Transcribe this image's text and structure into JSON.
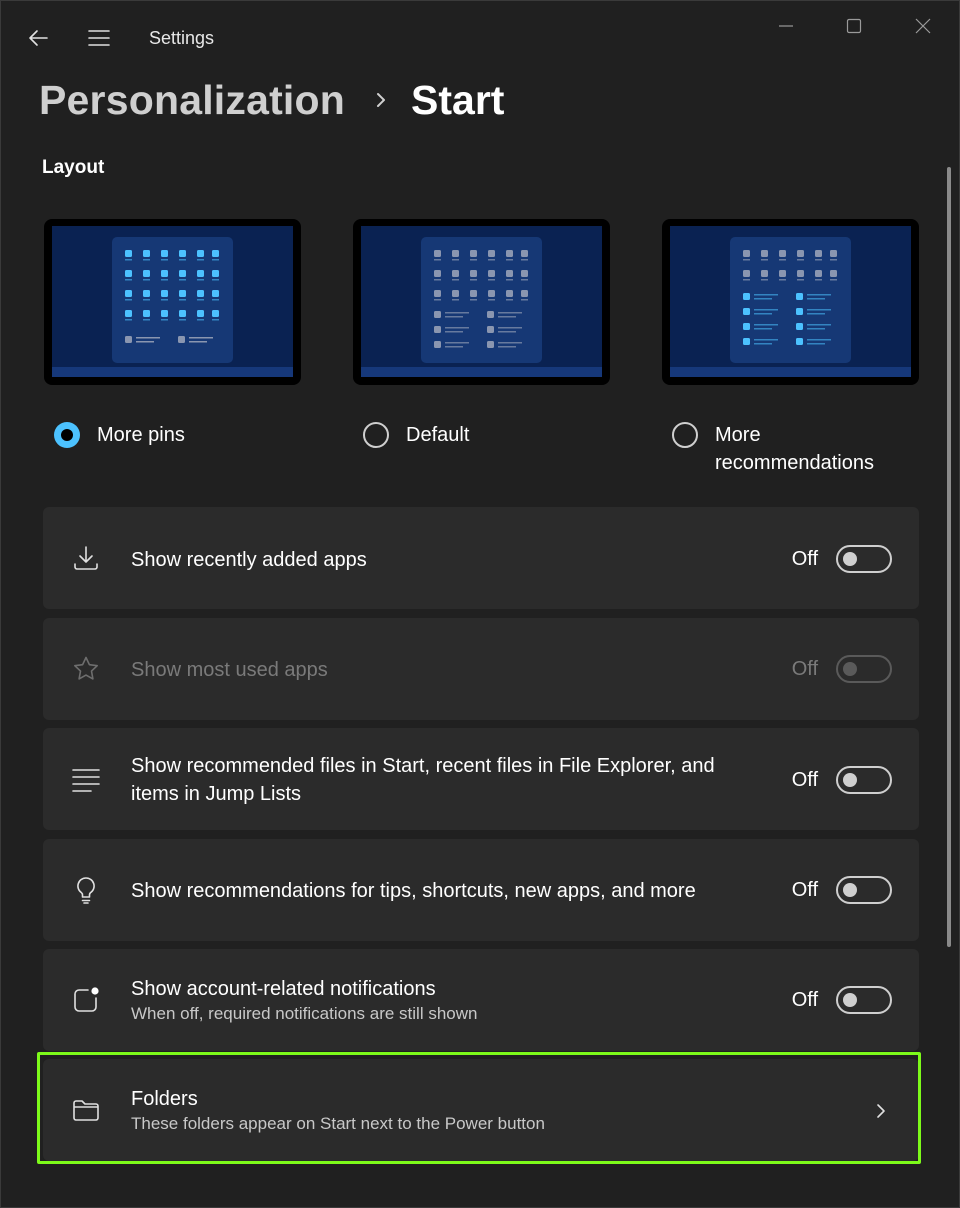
{
  "window": {
    "title": "Settings"
  },
  "breadcrumb": {
    "parent": "Personalization",
    "current": "Start"
  },
  "layout": {
    "section_title": "Layout",
    "options": [
      {
        "label": "More pins",
        "selected": true
      },
      {
        "label": "Default",
        "selected": false
      },
      {
        "label": "More\nrecommendations",
        "selected": false
      }
    ]
  },
  "settings": [
    {
      "title": "Show recently added apps",
      "state": "Off",
      "icon": "download-icon",
      "enabled": true
    },
    {
      "title": "Show most used apps",
      "state": "Off",
      "icon": "star-icon",
      "enabled": false
    },
    {
      "title": "Show recommended files in Start, recent files in File Explorer, and items in Jump Lists",
      "state": "Off",
      "icon": "list-icon",
      "enabled": true
    },
    {
      "title": "Show recommendations for tips, shortcuts, new apps, and more",
      "state": "Off",
      "icon": "lightbulb-icon",
      "enabled": true
    },
    {
      "title": "Show account-related notifications",
      "description": "When off, required notifications are still shown",
      "state": "Off",
      "icon": "notification-icon",
      "enabled": true
    }
  ],
  "folders": {
    "title": "Folders",
    "description": "These folders appear on Start next to the Power button",
    "icon": "folder-icon"
  },
  "colors": {
    "accent": "#4cc2ff",
    "highlight": "#7dfa1a",
    "card": "#2b2b2b",
    "background": "#202020"
  }
}
